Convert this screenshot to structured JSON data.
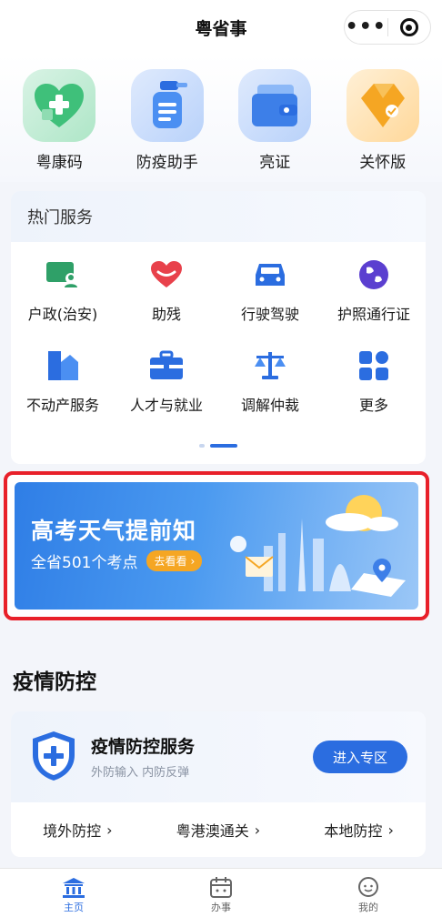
{
  "header": {
    "title": "粤省事",
    "more_icon": "more-dots-icon",
    "target_icon": "target-icon"
  },
  "top_items": [
    {
      "label": "粤康码",
      "icon": "health-code-icon",
      "color": "#3fc07a"
    },
    {
      "label": "防疫助手",
      "icon": "spray-icon",
      "color": "#4b8ff2"
    },
    {
      "label": "亮证",
      "icon": "card-wallet-icon",
      "color": "#3d7fe8"
    },
    {
      "label": "关怀版",
      "icon": "care-ribbon-icon",
      "color": "#f5a623"
    }
  ],
  "hot_services": {
    "title": "热门服务",
    "items": [
      {
        "label": "户政(治安)",
        "icon": "id-card-icon",
        "color": "#2fa068"
      },
      {
        "label": "助残",
        "icon": "heart-icon",
        "color": "#e8414b"
      },
      {
        "label": "行驶驾驶",
        "icon": "car-icon",
        "color": "#2b6de0"
      },
      {
        "label": "护照通行证",
        "icon": "globe-icon",
        "color": "#5b3fd0"
      },
      {
        "label": "不动产服务",
        "icon": "house-icon",
        "color": "#2b6de0"
      },
      {
        "label": "人才与就业",
        "icon": "briefcase-icon",
        "color": "#2b6de0"
      },
      {
        "label": "调解仲裁",
        "icon": "scale-icon",
        "color": "#2b6de0"
      },
      {
        "label": "更多",
        "icon": "grid-icon",
        "color": "#2b6de0"
      }
    ]
  },
  "banner": {
    "title": "高考天气提前知",
    "subtitle": "全省501个考点",
    "button": "去看看"
  },
  "epidemic": {
    "section_title": "疫情防控",
    "card_title": "疫情防控服务",
    "card_desc": "外防输入 内防反弹",
    "enter_button": "进入专区",
    "links": [
      "境外防控",
      "粤港澳通关",
      "本地防控"
    ]
  },
  "tabbar": [
    {
      "label": "主页",
      "icon": "home-icon",
      "active": true
    },
    {
      "label": "办事",
      "icon": "calendar-icon",
      "active": false
    },
    {
      "label": "我的",
      "icon": "face-icon",
      "active": false
    }
  ],
  "colors": {
    "accent": "#2b6de0",
    "highlight_border": "#e8202a"
  }
}
